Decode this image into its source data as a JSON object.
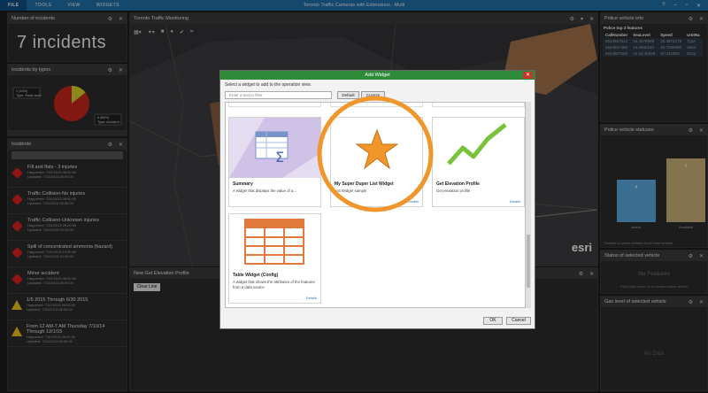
{
  "window": {
    "title": "Toronto Traffic Cameras with Extensions - Multi"
  },
  "menu": [
    {
      "label": "FILE",
      "active": true
    },
    {
      "label": "TOOLS"
    },
    {
      "label": "VIEW"
    },
    {
      "label": "WIDGETS"
    }
  ],
  "incident_count_panel": {
    "title": "Number of incidents",
    "value": "7 incidents"
  },
  "types_panel": {
    "title": "Incidents by types",
    "chart_data": {
      "type": "pie",
      "labels": [
        "Type: Road work",
        "Type: Accident"
      ],
      "values": [
        1,
        6
      ],
      "value_labels": [
        "1 (14%)",
        "6 (86%)"
      ],
      "colors": [
        "#d8d32a",
        "#c7261b"
      ]
    }
  },
  "incidents_panel": {
    "title": "Incidents",
    "items": [
      {
        "title": "Fill and flats - 3 injuries",
        "line1": "Happened: 7/31/2013 08:00:00",
        "line2": "Updated: 7/31/2013 08:00:00",
        "severity": "red"
      },
      {
        "title": "Traffic Collision-No injuries",
        "line1": "Happened: 7/31/2013 09:00:00",
        "line2": "Updated: 7/31/2013 09:00:00",
        "severity": "red"
      },
      {
        "title": "Traffic Collision-Unknown injuries",
        "line1": "Happened: 7/31/2013 09:20:00",
        "line2": "Updated: 7/31/2013 09:20:00",
        "severity": "red"
      },
      {
        "title": "Spill of concentrated ammonia (hazard)",
        "line1": "Happened: 7/31/2013 10:00:00",
        "line2": "Updated: 7/31/2013 10:00:00",
        "severity": "red"
      },
      {
        "title": "Minor accident",
        "line1": "Happened: 7/31/2013 08:00:00",
        "line2": "Updated: 7/31/2013 08:00:00",
        "severity": "red"
      },
      {
        "title": "1/5 2015 Through 6/30 2015",
        "line1": "Happened: 7/31/2013 08:00:00",
        "line2": "Updated: 7/31/2013 08:00:00",
        "severity": "yellow"
      },
      {
        "title": "From 12 AM-7 AM Thursday 7/10/14 Through 12/1/15",
        "line1": "Happened: 7/31/2013 08:00:00",
        "line2": "Updated: 7/31/2013 08:00:00",
        "severity": "yellow"
      }
    ]
  },
  "map_panel": {
    "title": "Toronto Traffic Monitoring",
    "attribution": "esri"
  },
  "elevation_panel": {
    "title": "New Get Elevation Profile",
    "clear_label": "Clear Line"
  },
  "police_info_panel": {
    "title": "Police vehicle info",
    "subtitle": "Police top 3 features",
    "columns": [
      "CallNumber",
      "SeaLevel",
      "Speed",
      "UnitNa"
    ],
    "rows": [
      [
        "4544567513",
        "16.4578969",
        "26.4572179",
        "Type"
      ],
      [
        "4544567466",
        "16.4800140",
        "40.7009980",
        "4864"
      ],
      [
        "4544567528",
        "no 16.46628",
        "37.041893",
        "8132"
      ]
    ]
  },
  "statuses_panel": {
    "title": "Police vehicle statuses",
    "chart_data": {
      "type": "bar",
      "categories": [
        "Active",
        "Available"
      ],
      "values": [
        4,
        6
      ],
      "value_labels": [
        "4",
        "6"
      ],
      "colors": [
        "#5ba9e1",
        "#c9b27a"
      ],
      "ylim": [
        0,
        7
      ]
    },
    "footnote": "Number of police vehicles for all view vehicles"
  },
  "status_selected_panel": {
    "title": "Status of selected vehicle",
    "empty": "No Features",
    "hint": "Right click below on an incident place vehicle"
  },
  "gas_panel": {
    "title": "Gas level of selected vehicle",
    "empty": "No Data"
  },
  "dialog": {
    "title": "Add Widget",
    "subtitle": "Select a widget to add to the operation view.",
    "search_placeholder": "Enter a text to filter",
    "tab_default": "Default",
    "tab_custom": "Custom",
    "ok": "OK",
    "cancel": "Cancel",
    "cards": [
      {
        "name": "Summary",
        "desc": "A widget that displays the value of a...",
        "link": "Details"
      },
      {
        "name": "My Super Duper List Widget",
        "desc": "List Widget sample",
        "link": "Details"
      },
      {
        "name": "Get Elevation Profile",
        "desc": "Get elevation profile",
        "link": "Details"
      },
      {
        "name": "Table Widget (Config)",
        "desc": "A widget that shows the attributes of the features from a data source",
        "link": "Details"
      }
    ]
  },
  "accent": {
    "title_bar": "#1f6fa8",
    "highlight_ring": "#f0962b",
    "dialog_title": "#2e8b3a"
  }
}
